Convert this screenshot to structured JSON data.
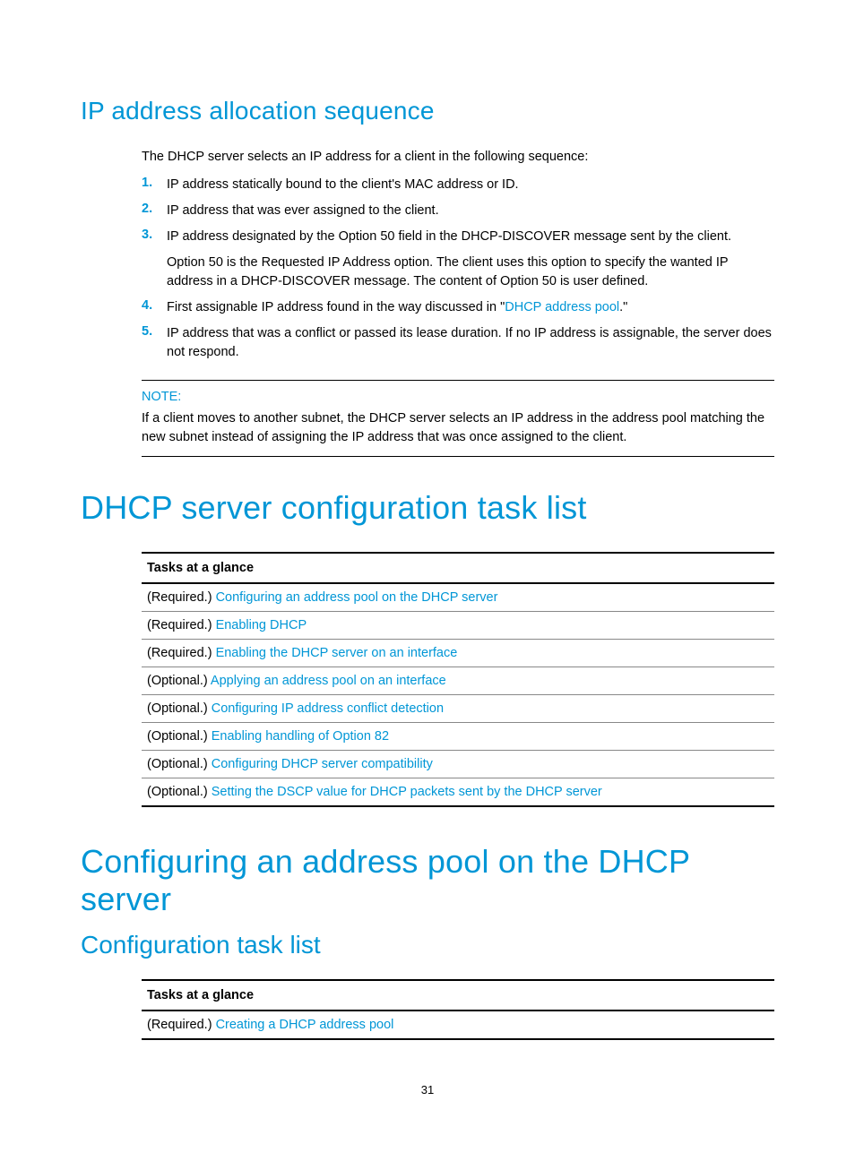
{
  "section1": {
    "title": "IP address allocation sequence",
    "intro": "The DHCP server selects an IP address for a client in the following sequence:",
    "steps": [
      {
        "n": "1.",
        "text": "IP address statically bound to the client's MAC address or ID."
      },
      {
        "n": "2.",
        "text": "IP address that was ever assigned to the client."
      },
      {
        "n": "3.",
        "text": "IP address designated by the Option 50 field in the DHCP-DISCOVER message sent by the client.",
        "sub": "Option 50 is the Requested IP Address option. The client uses this option to specify the wanted IP address in a DHCP-DISCOVER message. The content of Option 50 is user defined."
      },
      {
        "n": "4.",
        "pre": "First assignable IP address found in the way discussed in \"",
        "link": "DHCP address pool",
        "post": ".\""
      },
      {
        "n": "5.",
        "text": "IP address that was a conflict or passed its lease duration. If no IP address is assignable, the server does not respond."
      }
    ],
    "note_label": "NOTE:",
    "note_text": "If a client moves to another subnet, the DHCP server selects an IP address in the address pool matching the new subnet instead of assigning the IP address that was once assigned to the client."
  },
  "section2": {
    "title": "DHCP server configuration task list",
    "header": "Tasks at a glance",
    "rows": [
      {
        "prefix": "(Required.) ",
        "link": "Configuring an address pool on the DHCP server"
      },
      {
        "prefix": "(Required.) ",
        "link": "Enabling DHCP"
      },
      {
        "prefix": "(Required.) ",
        "link": "Enabling the DHCP server on an interface"
      },
      {
        "prefix": "(Optional.) ",
        "link": "Applying an address pool on an interface"
      },
      {
        "prefix": "(Optional.) ",
        "link": "Configuring IP address conflict detection"
      },
      {
        "prefix": "(Optional.) ",
        "link": "Enabling handling of Option 82"
      },
      {
        "prefix": "(Optional.) ",
        "link": "Configuring DHCP server compatibility"
      },
      {
        "prefix": "(Optional.) ",
        "link": "Setting the DSCP value for DHCP packets sent by the DHCP server"
      }
    ]
  },
  "section3": {
    "title": "Configuring an address pool on the DHCP server",
    "subtitle": "Configuration task list",
    "header": "Tasks at a glance",
    "rows": [
      {
        "prefix": "(Required.) ",
        "link": "Creating a DHCP address pool"
      }
    ]
  },
  "page_number": "31"
}
